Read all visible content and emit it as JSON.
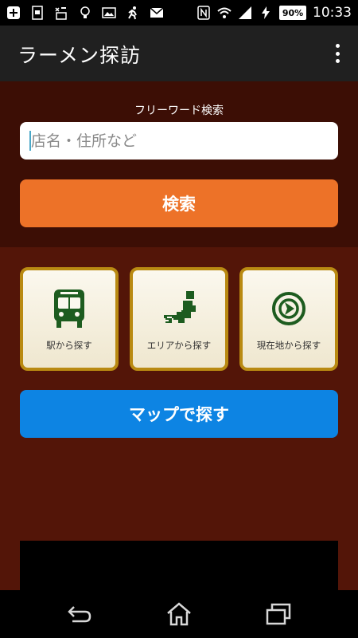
{
  "status_bar": {
    "battery": "90%",
    "time": "10:33",
    "icons_left": [
      "add-app-icon",
      "screenshot-icon",
      "nfc-tag-icon",
      "lightbulb-icon",
      "photo-icon",
      "runner-icon",
      "mail-icon"
    ],
    "icons_right": [
      "nfc-icon",
      "wifi-icon",
      "signal-icon",
      "battery-charging-icon"
    ]
  },
  "app_bar": {
    "title": "ラーメン探訪"
  },
  "search": {
    "label": "フリーワード検索",
    "placeholder": "店名・住所など",
    "value": "",
    "button_label": "検索"
  },
  "tiles": [
    {
      "label": "駅から探す",
      "icon": "train-icon"
    },
    {
      "label": "エリアから探す",
      "icon": "japan-map-icon"
    },
    {
      "label": "現在地から探す",
      "icon": "location-icon"
    }
  ],
  "map_button": {
    "label": "マップで探す"
  },
  "colors": {
    "app_bar": "#202020",
    "search_bg": "#3c0e05",
    "main_bg": "#531508",
    "search_button": "#ed7228",
    "map_button": "#0d84e3",
    "tile_border": "#b98a12",
    "icon_green": "#1d5c1f"
  },
  "nav_bar": {
    "buttons": [
      "back-icon",
      "home-icon",
      "recent-apps-icon"
    ]
  }
}
